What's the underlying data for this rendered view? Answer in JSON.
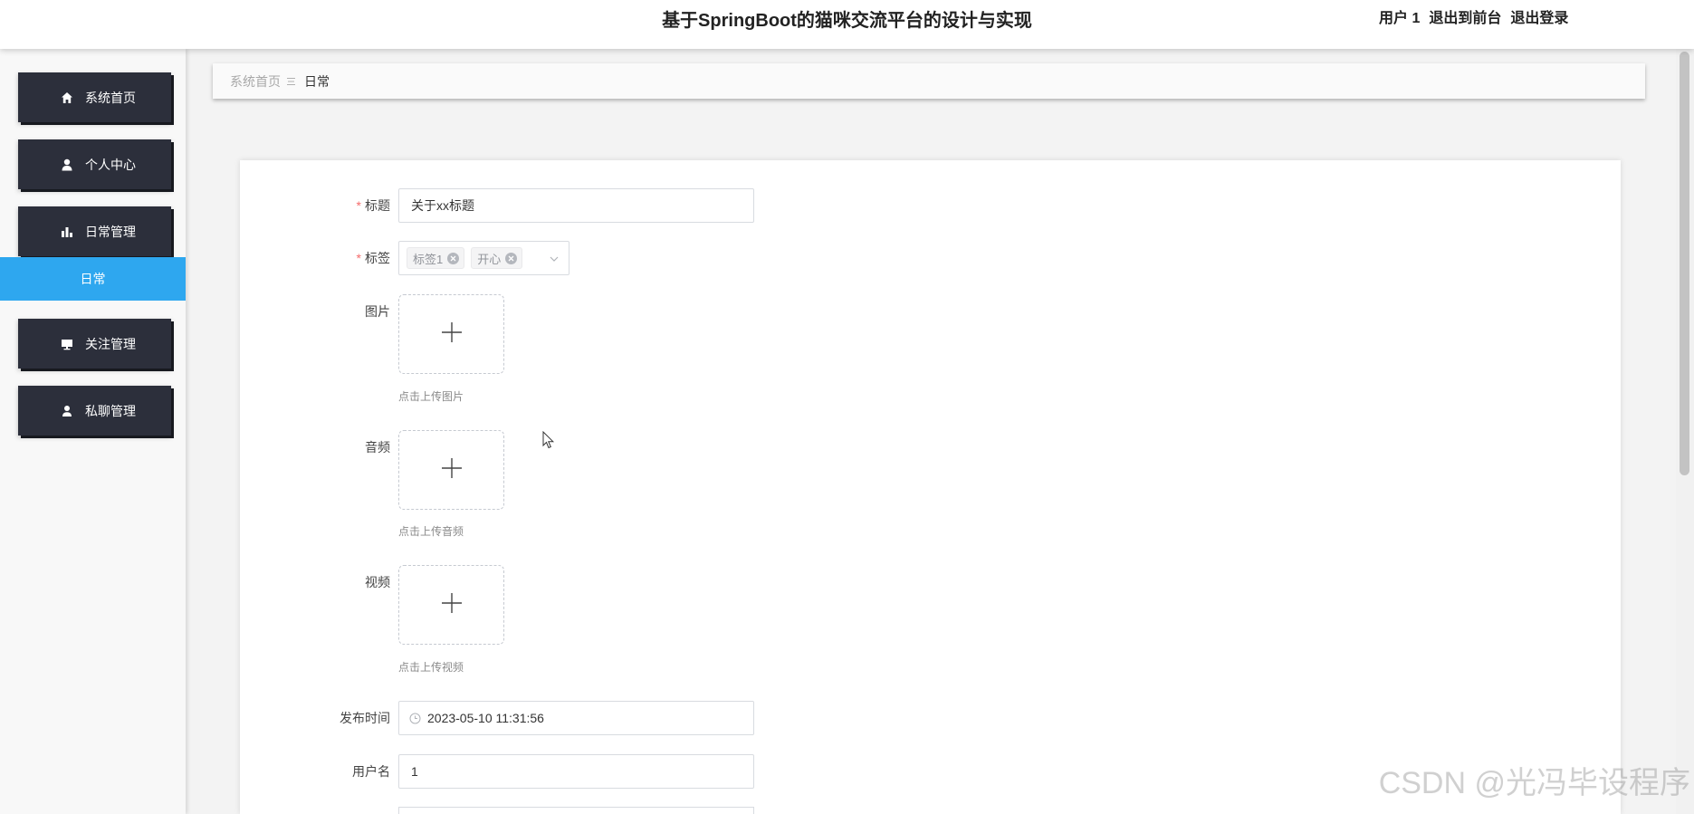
{
  "header": {
    "title": "基于SpringBoot的猫咪交流平台的设计与实现",
    "user_label": "用户 1",
    "to_front": "退出到前台",
    "logout": "退出登录"
  },
  "sidebar": {
    "items": [
      {
        "label": "系统首页",
        "icon": "home-icon"
      },
      {
        "label": "个人中心",
        "icon": "user-icon"
      },
      {
        "label": "日常管理",
        "icon": "bar-chart-icon"
      },
      {
        "label": "关注管理",
        "icon": "monitor-icon"
      },
      {
        "label": "私聊管理",
        "icon": "person-icon"
      }
    ],
    "active_sub": "日常"
  },
  "breadcrumb": {
    "home": "系统首页",
    "separator_icon": "menu-icon",
    "current": "日常"
  },
  "form": {
    "required_mark": "*",
    "title": {
      "label": "标题",
      "value": "关于xx标题"
    },
    "tags": {
      "label": "标签",
      "values": [
        "标签1",
        "开心"
      ]
    },
    "image": {
      "label": "图片",
      "hint": "点击上传图片"
    },
    "audio": {
      "label": "音频",
      "hint": "点击上传音频"
    },
    "video": {
      "label": "视频",
      "hint": "点击上传视频"
    },
    "publish_time": {
      "label": "发布时间",
      "value": "2023-05-10 11:31:56"
    },
    "username": {
      "label": "用户名",
      "value": "1"
    }
  },
  "watermark": "CSDN @光冯毕设程序",
  "colors": {
    "accent": "#2ea7ef",
    "menu_bg": "#2c2f3b",
    "required": "#f56c6c"
  }
}
